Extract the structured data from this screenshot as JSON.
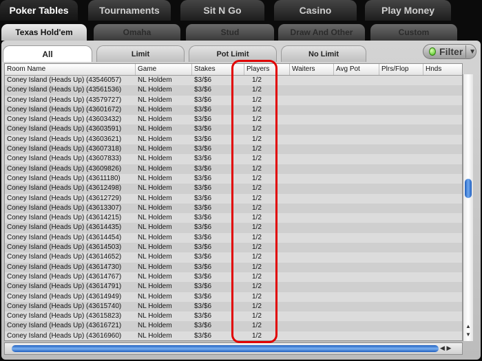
{
  "top_tabs": [
    "Poker Tables",
    "Tournaments",
    "Sit N Go",
    "Casino",
    "Play Money"
  ],
  "game_tabs": [
    "Texas Hold'em",
    "Omaha",
    "Stud",
    "Draw And Other",
    "Custom"
  ],
  "limit_tabs": [
    "All",
    "Limit",
    "Pot Limit",
    "No Limit"
  ],
  "filter": {
    "label": "Filter"
  },
  "columns": [
    "Room Name",
    "Game",
    "Stakes",
    "Players",
    "Waiters",
    "Avg Pot",
    "Plrs/Flop",
    "Hnds"
  ],
  "rows": [
    {
      "room": "Coney Island (Heads Up) (43546057)",
      "game": "NL Holdem",
      "stakes": "$3/$6",
      "players": "1/2"
    },
    {
      "room": "Coney Island (Heads Up) (43561536)",
      "game": "NL Holdem",
      "stakes": "$3/$6",
      "players": "1/2"
    },
    {
      "room": "Coney Island (Heads Up) (43579727)",
      "game": "NL Holdem",
      "stakes": "$3/$6",
      "players": "1/2"
    },
    {
      "room": "Coney Island (Heads Up) (43601672)",
      "game": "NL Holdem",
      "stakes": "$3/$6",
      "players": "1/2"
    },
    {
      "room": "Coney Island (Heads Up) (43603432)",
      "game": "NL Holdem",
      "stakes": "$3/$6",
      "players": "1/2"
    },
    {
      "room": "Coney Island (Heads Up) (43603591)",
      "game": "NL Holdem",
      "stakes": "$3/$6",
      "players": "1/2"
    },
    {
      "room": "Coney Island (Heads Up) (43603621)",
      "game": "NL Holdem",
      "stakes": "$3/$6",
      "players": "1/2"
    },
    {
      "room": "Coney Island (Heads Up) (43607318)",
      "game": "NL Holdem",
      "stakes": "$3/$6",
      "players": "1/2"
    },
    {
      "room": "Coney Island (Heads Up) (43607833)",
      "game": "NL Holdem",
      "stakes": "$3/$6",
      "players": "1/2"
    },
    {
      "room": "Coney Island (Heads Up) (43609826)",
      "game": "NL Holdem",
      "stakes": "$3/$6",
      "players": "1/2"
    },
    {
      "room": "Coney Island (Heads Up) (43611180)",
      "game": "NL Holdem",
      "stakes": "$3/$6",
      "players": "1/2"
    },
    {
      "room": "Coney Island (Heads Up) (43612498)",
      "game": "NL Holdem",
      "stakes": "$3/$6",
      "players": "1/2"
    },
    {
      "room": "Coney Island (Heads Up) (43612729)",
      "game": "NL Holdem",
      "stakes": "$3/$6",
      "players": "1/2"
    },
    {
      "room": "Coney Island (Heads Up) (43613307)",
      "game": "NL Holdem",
      "stakes": "$3/$6",
      "players": "1/2"
    },
    {
      "room": "Coney Island (Heads Up) (43614215)",
      "game": "NL Holdem",
      "stakes": "$3/$6",
      "players": "1/2"
    },
    {
      "room": "Coney Island (Heads Up) (43614435)",
      "game": "NL Holdem",
      "stakes": "$3/$6",
      "players": "1/2"
    },
    {
      "room": "Coney Island (Heads Up) (43614454)",
      "game": "NL Holdem",
      "stakes": "$3/$6",
      "players": "1/2"
    },
    {
      "room": "Coney Island (Heads Up) (43614503)",
      "game": "NL Holdem",
      "stakes": "$3/$6",
      "players": "1/2"
    },
    {
      "room": "Coney Island (Heads Up) (43614652)",
      "game": "NL Holdem",
      "stakes": "$3/$6",
      "players": "1/2"
    },
    {
      "room": "Coney Island (Heads Up) (43614730)",
      "game": "NL Holdem",
      "stakes": "$3/$6",
      "players": "1/2"
    },
    {
      "room": "Coney Island (Heads Up) (43614767)",
      "game": "NL Holdem",
      "stakes": "$3/$6",
      "players": "1/2"
    },
    {
      "room": "Coney Island (Heads Up) (43614791)",
      "game": "NL Holdem",
      "stakes": "$3/$6",
      "players": "1/2"
    },
    {
      "room": "Coney Island (Heads Up) (43614949)",
      "game": "NL Holdem",
      "stakes": "$3/$6",
      "players": "1/2"
    },
    {
      "room": "Coney Island (Heads Up) (43615740)",
      "game": "NL Holdem",
      "stakes": "$3/$6",
      "players": "1/2"
    },
    {
      "room": "Coney Island (Heads Up) (43615823)",
      "game": "NL Holdem",
      "stakes": "$3/$6",
      "players": "1/2"
    },
    {
      "room": "Coney Island (Heads Up) (43616721)",
      "game": "NL Holdem",
      "stakes": "$3/$6",
      "players": "1/2"
    },
    {
      "room": "Coney Island (Heads Up) (43616960)",
      "game": "NL Holdem",
      "stakes": "$3/$6",
      "players": "1/2"
    }
  ],
  "colors": {
    "highlight": "#e10000",
    "scroll_thumb": "#2f6fd0"
  }
}
